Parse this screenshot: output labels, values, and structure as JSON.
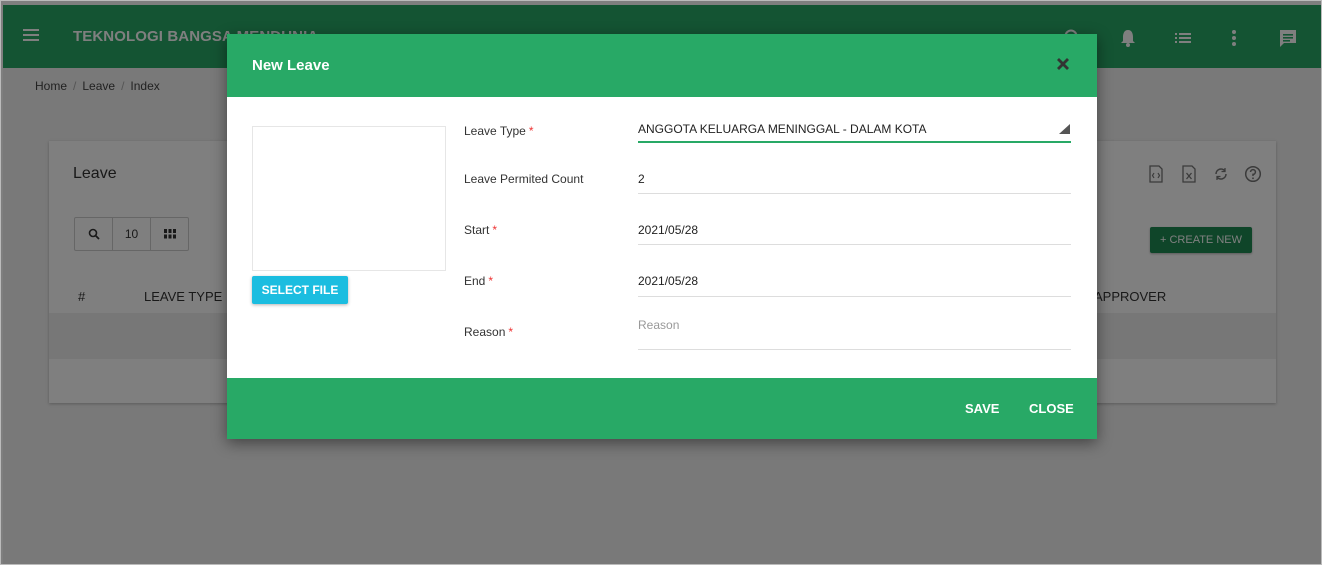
{
  "app": {
    "brand": "TEKNOLOGI BANGSA MENDUNIA",
    "header_icons": [
      "menu-icon",
      "search-icon",
      "bell-icon",
      "list-icon",
      "more-vert-icon",
      "chat-icon"
    ]
  },
  "breadcrumb": {
    "items": [
      "Home",
      "Leave",
      "Index"
    ],
    "separator": "/"
  },
  "card": {
    "title": "Leave",
    "page_size": "10",
    "create_label": "+ CREATE NEW",
    "columns": [
      "#",
      "LEAVE TYPE",
      "APPROVER"
    ],
    "tool_icons": [
      "export-html-icon",
      "export-excel-icon",
      "refresh-icon",
      "help-icon"
    ]
  },
  "modal": {
    "title": "New Leave",
    "select_file_label": "SELECT FILE",
    "fields": {
      "leave_type": {
        "label": "Leave Type",
        "required": "*",
        "value": "ANGGOTA KELUARGA MENINGGAL - DALAM KOTA"
      },
      "permited_count": {
        "label": "Leave Permited Count",
        "value": "2"
      },
      "start": {
        "label": "Start",
        "required": "*",
        "value": "2021/05/28"
      },
      "end": {
        "label": "End",
        "required": "*",
        "value": "2021/05/28"
      },
      "reason": {
        "label": "Reason",
        "required": "*",
        "placeholder": "Reason",
        "value": ""
      }
    },
    "save_label": "SAVE",
    "close_label": "CLOSE"
  },
  "colors": {
    "primary": "#28a966",
    "primary_dark": "#1e8b52",
    "select_file": "#1bbde0",
    "required": "#ee3333",
    "overlay": "rgba(0,0,0,0.5)"
  }
}
